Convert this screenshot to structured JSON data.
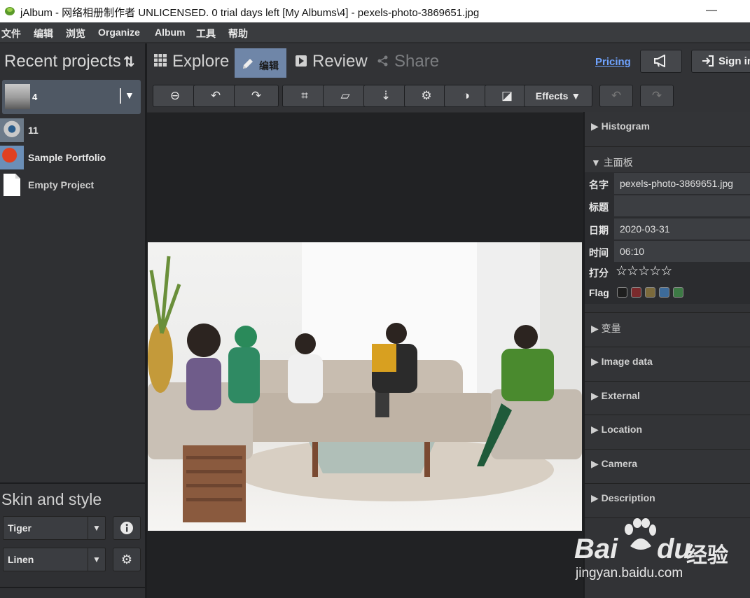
{
  "window": {
    "title": "jAlbum - 网络相册制作者 UNLICENSED. 0 trial days left [My Albums\\4] - pexels-photo-3869651.jpg",
    "minimize": "—"
  },
  "menu": [
    "文件",
    "编辑",
    "浏览",
    "Organize",
    "Album",
    "工具",
    "帮助"
  ],
  "left": {
    "recent_title": "Recent projects",
    "projects": [
      {
        "name": "4"
      },
      {
        "name": "11"
      },
      {
        "name": "Sample Portfolio"
      },
      {
        "name": "Empty Project"
      }
    ],
    "skin_title": "Skin and style",
    "skin": "Tiger",
    "style": "Linen"
  },
  "tabs": {
    "explore": "Explore",
    "edit": "编辑",
    "review": "Review",
    "share": "Share"
  },
  "header_right": {
    "pricing": "Pricing",
    "sign_in": "Sign in"
  },
  "toolbar": {
    "effects": "Effects"
  },
  "right_panel": {
    "histogram": "Histogram",
    "main_panel": "主面板",
    "fields": {
      "name_label": "名字",
      "name_value": "pexels-photo-3869651.jpg",
      "title_label": "标题",
      "title_value": "",
      "date_label": "日期",
      "date_value": "2020-03-31",
      "time_label": "时间",
      "time_value": "06:10",
      "rating_label": "打分",
      "rating_value": 0,
      "rating_max": 5,
      "flag_label": "Flag"
    },
    "flag_colors": [
      "#1e1e1e",
      "#7a2a2c",
      "#7b6a3c",
      "#3d6b9a",
      "#3d7a45"
    ],
    "sections": [
      "变量",
      "Image data",
      "External",
      "Location",
      "Camera",
      "Description"
    ]
  },
  "watermark": {
    "brand": "Bai",
    "brand2": "du",
    "cn": "经验",
    "url": "jingyan.baidu.com"
  }
}
